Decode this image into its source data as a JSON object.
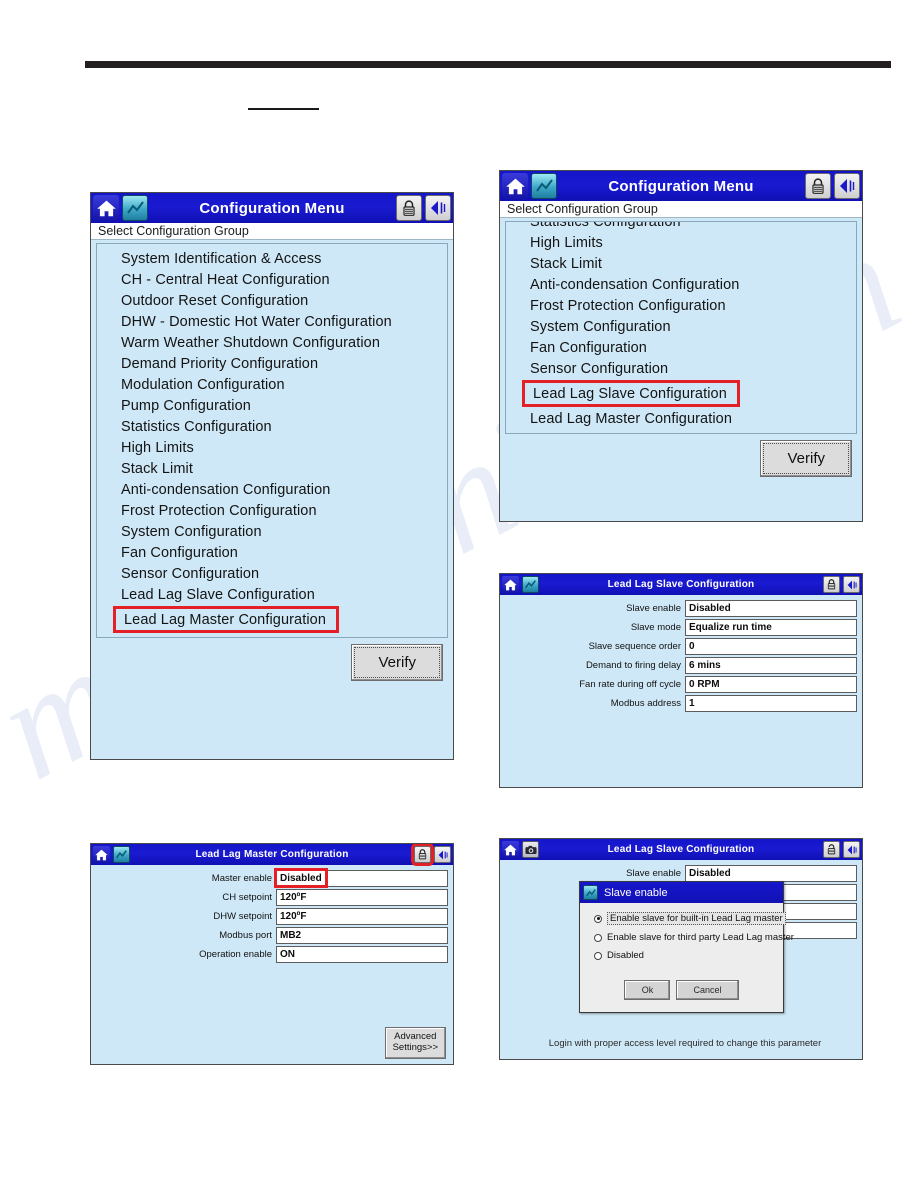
{
  "watermark_text": "manualshive.com",
  "panel_config_menu_1": {
    "title": "Configuration Menu",
    "subheader": "Select Configuration Group",
    "items": [
      "System Identification & Access",
      "CH - Central Heat Configuration",
      "Outdoor Reset Configuration",
      "DHW - Domestic Hot Water Configuration",
      "Warm Weather Shutdown Configuration",
      "Demand Priority Configuration",
      "Modulation Configuration",
      "Pump Configuration",
      "Statistics Configuration",
      "High Limits",
      "Stack Limit",
      "Anti-condensation Configuration",
      "Frost Protection Configuration",
      "System Configuration",
      "Fan Configuration",
      "Sensor Configuration",
      "Lead Lag Slave Configuration"
    ],
    "highlighted_item": "Lead Lag Master Configuration",
    "verify_label": "Verify"
  },
  "panel_config_menu_2": {
    "title": "Configuration Menu",
    "subheader": "Select Configuration Group",
    "clipped_item": "Statistics Configuration",
    "items": [
      "High Limits",
      "Stack Limit",
      "Anti-condensation Configuration",
      "Frost Protection Configuration",
      "System Configuration",
      "Fan Configuration",
      "Sensor Configuration"
    ],
    "highlighted_item": "Lead Lag Slave Configuration",
    "items_after": [
      "Lead Lag Master Configuration"
    ],
    "verify_label": "Verify"
  },
  "panel_slave_config": {
    "title": "Lead Lag Slave Configuration",
    "rows": [
      {
        "label": "Slave enable",
        "value": "Disabled"
      },
      {
        "label": "Slave mode",
        "value": "Equalize run time"
      },
      {
        "label": "Slave sequence order",
        "value": "0"
      },
      {
        "label": "Demand to firing delay",
        "value": "6 mins"
      },
      {
        "label": "Fan rate during off cycle",
        "value": "0 RPM"
      },
      {
        "label": "Modbus address",
        "value": "1"
      }
    ]
  },
  "panel_master_config": {
    "title": "Lead Lag Master Configuration",
    "rows": [
      {
        "label": "Master enable",
        "value": "Disabled"
      },
      {
        "label": "CH setpoint",
        "value": "120ºF"
      },
      {
        "label": "DHW setpoint",
        "value": "120ºF"
      },
      {
        "label": "Modbus port",
        "value": "MB2"
      },
      {
        "label": "Operation enable",
        "value": "ON"
      }
    ],
    "advanced_button": "Advanced\nSettings>>",
    "advanced_button_line1": "Advanced",
    "advanced_button_line2": "Settings>>"
  },
  "panel_slave_dialog": {
    "title": "Lead Lag Slave Configuration",
    "rows": [
      {
        "label": "Slave enable",
        "value": "Disabled"
      }
    ],
    "dialog": {
      "title": "Slave enable",
      "options": [
        {
          "label": "Enable slave for built-in Lead Lag master",
          "selected": true
        },
        {
          "label": "Enable slave for third party Lead Lag master",
          "selected": false
        },
        {
          "label": "Disabled",
          "selected": false
        }
      ],
      "ok_label": "Ok",
      "cancel_label": "Cancel"
    },
    "login_note": "Login with proper access level required to change this parameter"
  },
  "colors": {
    "titlebar_blue": "#1414c8",
    "panel_blue": "#cfe8f7",
    "highlight_red": "#e41f26",
    "button_gray": "#dcdcdc"
  },
  "icons": {
    "home": "home-icon",
    "graph": "graph-icon",
    "camera": "camera-icon",
    "lock": "lock-icon",
    "lock_open": "lock-open-icon",
    "back": "back-arrow-icon"
  }
}
